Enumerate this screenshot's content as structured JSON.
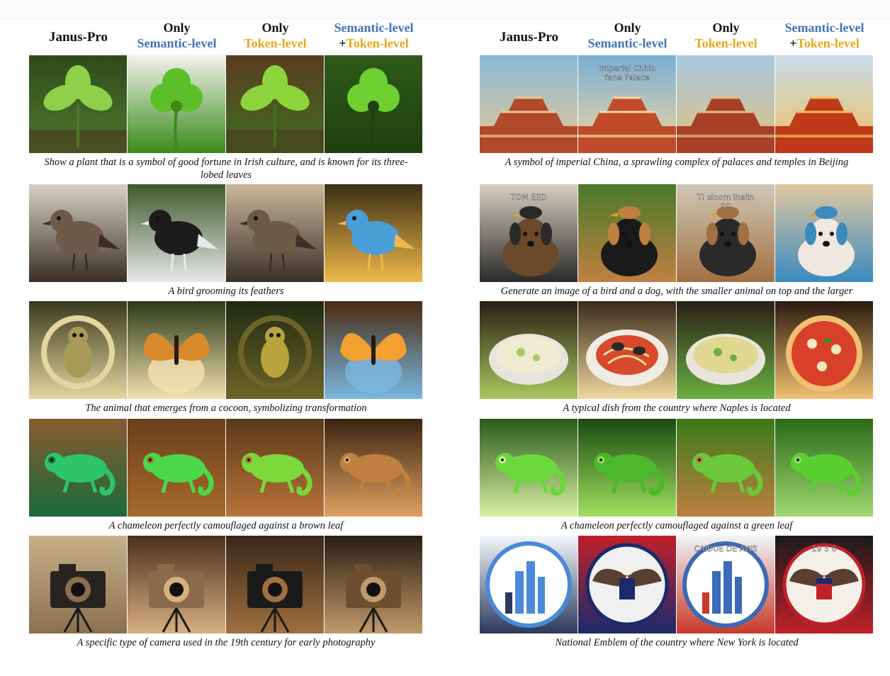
{
  "headers": {
    "janus": "Janus-Pro",
    "only": "Only",
    "semantic": "Semantic-level",
    "token": "Token-level",
    "semantic_plus": "Semantic-level",
    "plus_token": "+Token-level",
    "colors": {
      "semantic": "#3f73b8",
      "token": "#e6a816"
    }
  },
  "left_rows": [
    {
      "caption": "Show a plant that is a symbol of good fortune in Irish culture, and is known for its three-lobed leaves",
      "images": [
        {
          "subject": "green leafy plant",
          "palette": [
            "#2f4a1e",
            "#8fcf4a",
            "#4e7a2a"
          ],
          "icon": "plant-icon"
        },
        {
          "subject": "clover sprout",
          "palette": [
            "#f2f2ec",
            "#5cbf2a",
            "#3a8a1a"
          ],
          "icon": "clover-icon"
        },
        {
          "subject": "seedling in soil",
          "palette": [
            "#5a3b22",
            "#8cd43c",
            "#3f6f1f"
          ],
          "icon": "plant-icon"
        },
        {
          "subject": "four-leaf clover",
          "palette": [
            "#2e5a1a",
            "#6fd032",
            "#1f3f10"
          ],
          "icon": "clover-icon"
        }
      ]
    },
    {
      "caption": "A bird grooming its feathers",
      "images": [
        {
          "subject": "brown bird on post",
          "palette": [
            "#d9d2c4",
            "#6e5a48",
            "#3a2e24"
          ],
          "icon": "bird-icon"
        },
        {
          "subject": "spotted bird among flowers",
          "palette": [
            "#3d5a2a",
            "#1c1c1c",
            "#e8e8e8"
          ],
          "icon": "bird-icon"
        },
        {
          "subject": "bird on branch",
          "palette": [
            "#c9b89c",
            "#6b5a44",
            "#3a3026"
          ],
          "icon": "bird-icon"
        },
        {
          "subject": "colorful fluffy bird",
          "palette": [
            "#3a2e14",
            "#4a9ed8",
            "#f0b84a"
          ],
          "icon": "bird-icon"
        }
      ]
    },
    {
      "caption": "The animal that emerges from a cocoon, symbolizing transformation",
      "images": [
        {
          "subject": "creature in ring",
          "palette": [
            "#3a3a1e",
            "#a89a56",
            "#e4d6a0"
          ],
          "icon": "cocoon-icon"
        },
        {
          "subject": "butterfly on egg",
          "palette": [
            "#2a3a18",
            "#d88a2a",
            "#f4e0b0"
          ],
          "icon": "butterfly-icon"
        },
        {
          "subject": "small creature on shell",
          "palette": [
            "#1f2a12",
            "#b8a43a",
            "#6e6428"
          ],
          "icon": "cocoon-icon"
        },
        {
          "subject": "butterfly from egg",
          "palette": [
            "#4a2a10",
            "#f2a030",
            "#7ab8e0"
          ],
          "icon": "butterfly-icon"
        }
      ]
    },
    {
      "caption": "A chameleon perfectly camouflaged against a brown leaf",
      "images": [
        {
          "subject": "green chameleon",
          "palette": [
            "#8a5a30",
            "#2ec46a",
            "#1a6a3a"
          ],
          "icon": "chameleon-icon"
        },
        {
          "subject": "chameleon on leaves",
          "palette": [
            "#6a3f1a",
            "#4ad84a",
            "#a86a2a"
          ],
          "icon": "chameleon-icon"
        },
        {
          "subject": "chameleon on dry leaf",
          "palette": [
            "#5a3a1a",
            "#7ad83a",
            "#b8743a"
          ],
          "icon": "chameleon-icon"
        },
        {
          "subject": "brown chameleon",
          "palette": [
            "#3a2412",
            "#c08040",
            "#e0a060"
          ],
          "icon": "chameleon-icon"
        }
      ]
    },
    {
      "caption": "A specific type of camera used in the 19th century for early photography",
      "images": [
        {
          "subject": "vintage camera on table",
          "palette": [
            "#c8b08a",
            "#2a2420",
            "#8a7050"
          ],
          "icon": "camera-icon"
        },
        {
          "subject": "antique cameras",
          "palette": [
            "#4a3020",
            "#8a6a4a",
            "#d8b080"
          ],
          "icon": "camera-icon"
        },
        {
          "subject": "camera on wooden box",
          "palette": [
            "#3a2618",
            "#1a1a1a",
            "#a07040"
          ],
          "icon": "camera-icon"
        },
        {
          "subject": "camera on tripod",
          "palette": [
            "#2a1e14",
            "#6a5030",
            "#c09a6a"
          ],
          "icon": "camera-icon"
        }
      ]
    }
  ],
  "right_rows": [
    {
      "caption": "A symbol of imperial China, a sprawling complex of palaces and temples in Beijing",
      "images": [
        {
          "subject": "palace skyline",
          "palette": [
            "#8ab8d8",
            "#b04a2a",
            "#e8c890"
          ],
          "icon": "palace-icon"
        },
        {
          "subject": "palace with garbled title",
          "palette": [
            "#7aaed4",
            "#c04a2a",
            "#f0d8a0"
          ],
          "icon": "palace-icon",
          "overlay_text": "Imperial Chhio\nfane Palace"
        },
        {
          "subject": "palace complex",
          "palette": [
            "#a8c8e0",
            "#a84028",
            "#e0c080"
          ],
          "icon": "palace-icon"
        },
        {
          "subject": "forbidden city",
          "palette": [
            "#c8dcea",
            "#c03a1a",
            "#f0c060"
          ],
          "icon": "palace-icon"
        }
      ]
    },
    {
      "caption": "Generate an image of a bird and a dog, with the smaller animal on top and the larger",
      "images": [
        {
          "subject": "dogs with text",
          "palette": [
            "#d8d0c0",
            "#6a4a2a",
            "#2a2a2a"
          ],
          "icon": "dog-icon",
          "overlay_text": "TOM EED"
        },
        {
          "subject": "black dog and bird",
          "palette": [
            "#4a7a2a",
            "#1a1a1a",
            "#c08040"
          ],
          "icon": "dog-icon"
        },
        {
          "subject": "bird on dog",
          "palette": [
            "#d0c8b8",
            "#2a2a2a",
            "#a07040"
          ],
          "icon": "dog-icon",
          "overlay_text": "T! sloom lhalin\nSC"
        },
        {
          "subject": "bird on fluffy dog",
          "palette": [
            "#e0c8a0",
            "#f0e8e0",
            "#3a8ac0"
          ],
          "icon": "dog-icon"
        }
      ]
    },
    {
      "caption": "A typical dish from the country where Naples is located",
      "images": [
        {
          "subject": "soup in bowl",
          "palette": [
            "#2a1e14",
            "#f0ead0",
            "#a8c860"
          ],
          "icon": "bowl-icon"
        },
        {
          "subject": "spaghetti with clams",
          "palette": [
            "#3a2a1a",
            "#d84a2a",
            "#f0d8a0"
          ],
          "icon": "pasta-icon"
        },
        {
          "subject": "pasta salad",
          "palette": [
            "#2a2018",
            "#e0d890",
            "#6ab040"
          ],
          "icon": "bowl-icon"
        },
        {
          "subject": "pizza",
          "palette": [
            "#2a1a10",
            "#d8402a",
            "#f0c070"
          ],
          "icon": "pizza-icon"
        }
      ]
    },
    {
      "caption": "A chameleon perfectly camouflaged against a green leaf",
      "images": [
        {
          "subject": "chameleon on green leaf",
          "palette": [
            "#2a5a1a",
            "#6ad83a",
            "#d8f0a0"
          ],
          "icon": "chameleon-icon"
        },
        {
          "subject": "chameleon on leaf",
          "palette": [
            "#1a4a10",
            "#4ab82a",
            "#a0e060"
          ],
          "icon": "chameleon-icon"
        },
        {
          "subject": "small chameleon",
          "palette": [
            "#3a7a1a",
            "#6ac83a",
            "#c08040"
          ],
          "icon": "chameleon-icon"
        },
        {
          "subject": "chameleon on big leaf",
          "palette": [
            "#2a6a18",
            "#5ad030",
            "#a0d870"
          ],
          "icon": "chameleon-icon"
        }
      ]
    },
    {
      "caption": "National Emblem of the country where New York is located",
      "images": [
        {
          "subject": "city in ring",
          "palette": [
            "#f4f8fc",
            "#4a8ad8",
            "#2a3a5a"
          ],
          "icon": "emblem-icon"
        },
        {
          "subject": "eagle on flag",
          "palette": [
            "#c0202a",
            "#f0f0f0",
            "#1a2a6a"
          ],
          "icon": "eagle-icon"
        },
        {
          "subject": "emblem with skyline",
          "palette": [
            "#f0f4f8",
            "#3a6ab8",
            "#c83a2a"
          ],
          "icon": "emblem-icon",
          "overlay_text": "CAIDUE DE AWS"
        },
        {
          "subject": "eagle seal",
          "palette": [
            "#1a1a1a",
            "#f4f0e8",
            "#c0202a"
          ],
          "icon": "eagle-icon",
          "overlay_text": "19 5 6"
        }
      ]
    }
  ]
}
